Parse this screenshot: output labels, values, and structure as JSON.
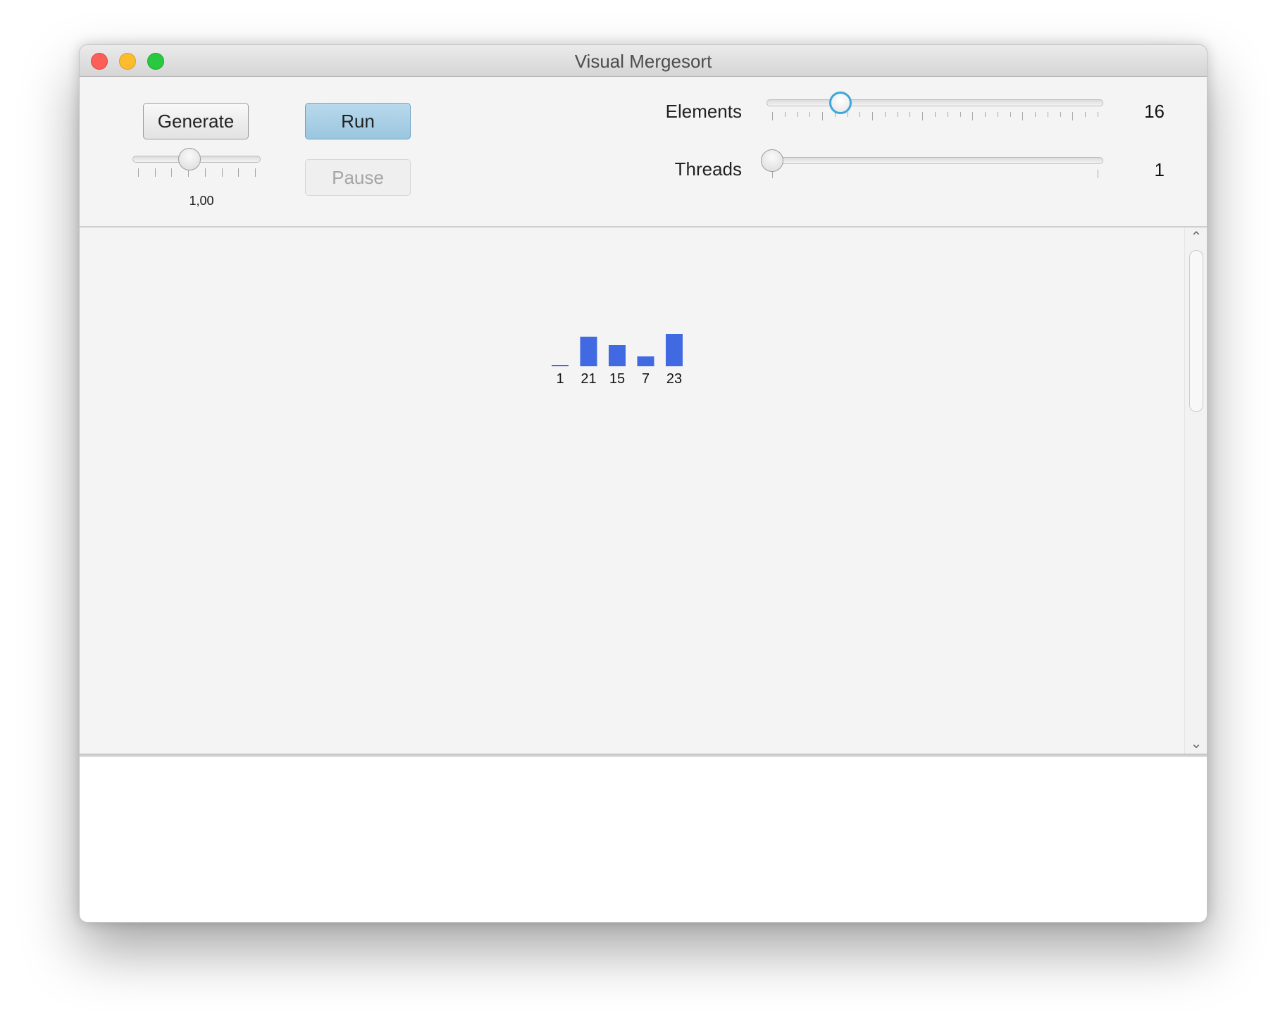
{
  "window": {
    "title": "Visual Mergesort"
  },
  "toolbar": {
    "generate_label": "Generate",
    "run_label": "Run",
    "pause_label": "Pause",
    "pause_enabled": false,
    "speed": {
      "value_text": "1,00",
      "position_fraction": 0.44
    }
  },
  "elements_slider": {
    "label": "Elements",
    "value": "16",
    "position_fraction": 0.21
  },
  "threads_slider": {
    "label": "Threads",
    "value": "1",
    "position_fraction": 0.0
  },
  "colors": {
    "bar": "#4169e1",
    "run_button": "#a9d0e6",
    "focus_ring": "#3ea6db"
  },
  "chart_data": {
    "type": "bar",
    "categories": [
      "1",
      "21",
      "15",
      "7",
      "23"
    ],
    "values": [
      1,
      21,
      15,
      7,
      23
    ]
  }
}
